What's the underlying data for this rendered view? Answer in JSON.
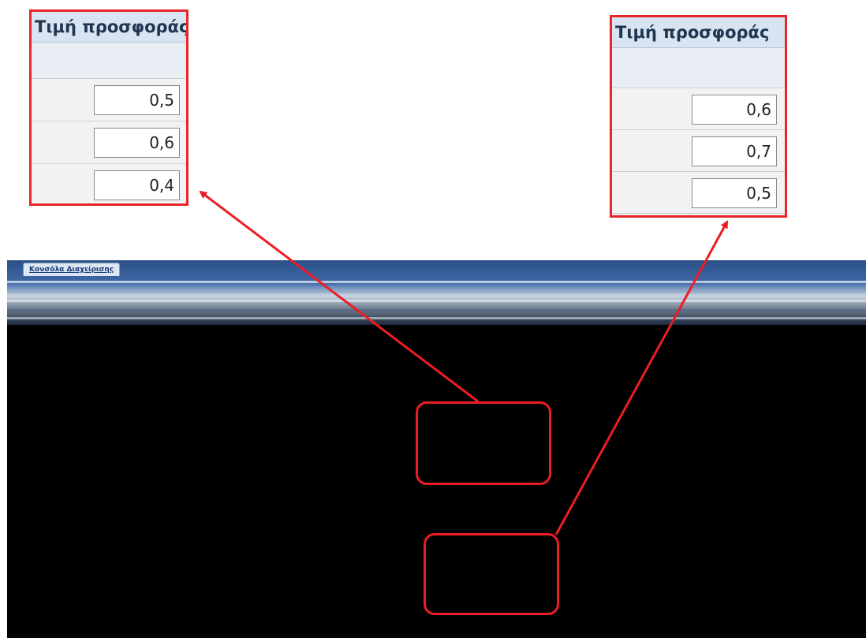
{
  "callouts": {
    "left": {
      "header": "Τιμή προσφοράς",
      "values": [
        "0,5",
        "0,6",
        "0,4"
      ]
    },
    "right": {
      "header": "Τιμή προσφοράς",
      "values": [
        "0,6",
        "0,7",
        "0,5"
      ]
    }
  },
  "console": {
    "tab_label": "Κονσόλα Διαχείρισης"
  },
  "colors": {
    "annotation_red": "#ee1c24",
    "header_blue": "#d8e4f1",
    "console_background": "#000000"
  }
}
